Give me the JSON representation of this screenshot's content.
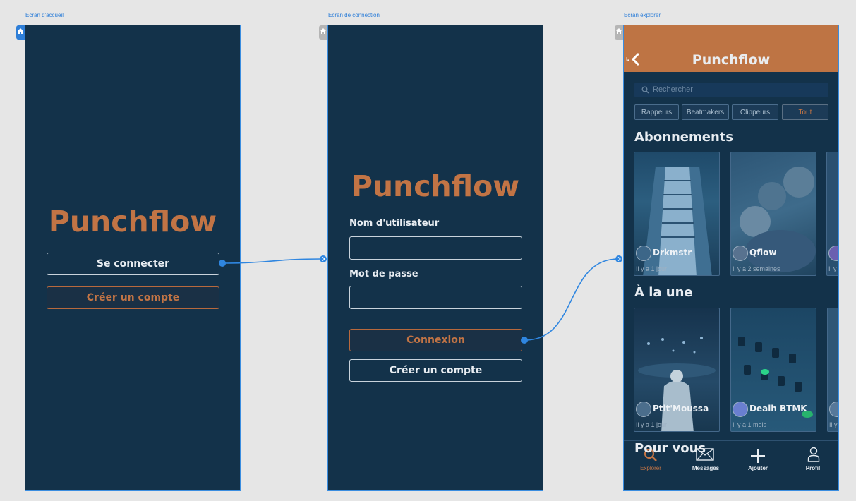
{
  "artboards": {
    "home": {
      "label": "Ecran d'accueil"
    },
    "login": {
      "label": "Ecran de connection"
    },
    "explore": {
      "label": "Ecran explorer"
    }
  },
  "home": {
    "brand": "Punchflow",
    "login_button": "Se connecter",
    "create_account_button": "Créer un compte"
  },
  "login": {
    "brand": "Punchflow",
    "username_label": "Nom d'utilisateur",
    "username_value": "",
    "password_label": "Mot de passe",
    "password_value": "",
    "submit_button": "Connexion",
    "create_account_button": "Créer un compte"
  },
  "explore": {
    "title": "Punchflow",
    "search_placeholder": "Rechercher",
    "filters": [
      "Rappeurs",
      "Beatmakers",
      "Clippeurs",
      "Tout"
    ],
    "active_filter": "Tout",
    "subscriptions_title": "Abonnements",
    "subscriptions": [
      {
        "name": "Drkmstr",
        "time": "Il y a 1 jour"
      },
      {
        "name": "Qflow",
        "time": "Il y a 2 semaines"
      },
      {
        "name": "",
        "time": "Il y"
      }
    ],
    "featured_title": "À la une",
    "featured": [
      {
        "name": "Ptit'Moussa",
        "time": "Il y a 1 jour"
      },
      {
        "name": "Dealh BTMK",
        "time": "Il y a 1 mois"
      },
      {
        "name": "",
        "time": "Il y"
      }
    ],
    "for_you_title": "Pour vous",
    "nav": [
      {
        "label": "Explorer",
        "icon": "search-icon",
        "active": true
      },
      {
        "label": "Messages",
        "icon": "envelope-icon",
        "active": false
      },
      {
        "label": "Ajouter",
        "icon": "plus-icon",
        "active": false
      },
      {
        "label": "Profil",
        "icon": "user-icon",
        "active": false
      }
    ]
  },
  "colors": {
    "canvas": "#e6e6e6",
    "screen_bg": "#13324a",
    "brand_orange": "#c27445",
    "header_orange": "#be7444",
    "selection_blue": "#2f7fd8"
  }
}
